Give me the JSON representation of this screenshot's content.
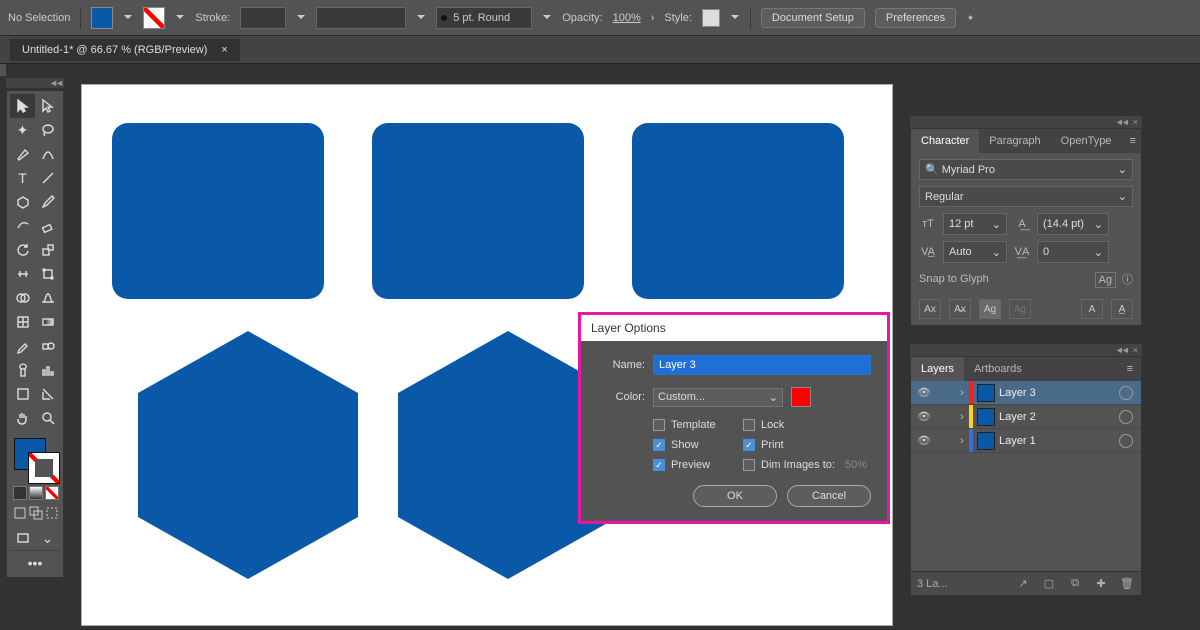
{
  "optbar": {
    "selection": "No Selection",
    "fill_color": "#0a58a8",
    "stroke_none": true,
    "stroke_label": "Stroke:",
    "brush_label": "5 pt. Round",
    "opacity_label": "Opacity:",
    "opacity_value": "100%",
    "style_label": "Style:",
    "doc_setup": "Document Setup",
    "prefs": "Preferences"
  },
  "tab": {
    "title": "Untitled-1* @ 66.67 % (RGB/Preview)",
    "close": "×"
  },
  "dialog": {
    "title": "Layer Options",
    "name_label": "Name:",
    "name_value": "Layer 3",
    "color_label": "Color:",
    "color_value": "Custom...",
    "color_swatch": "#ff0000",
    "template": "Template",
    "lock": "Lock",
    "show": "Show",
    "print": "Print",
    "preview": "Preview",
    "dim": "Dim Images to:",
    "dim_value": "50%",
    "ok": "OK",
    "cancel": "Cancel",
    "checks": {
      "template": false,
      "lock": false,
      "show": true,
      "print": true,
      "preview": true,
      "dim": false
    }
  },
  "char": {
    "tabs": [
      "Character",
      "Paragraph",
      "OpenType"
    ],
    "font": "Myriad Pro",
    "style": "Regular",
    "size": "12 pt",
    "leading": "(14.4 pt)",
    "kerning": "Auto",
    "tracking": "0",
    "snap_label": "Snap to Glyph"
  },
  "layers": {
    "tabs": [
      "Layers",
      "Artboards"
    ],
    "items": [
      {
        "name": "Layer 3",
        "color": "#ff1a1a",
        "selected": true
      },
      {
        "name": "Layer 2",
        "color": "#ffd11a",
        "selected": false
      },
      {
        "name": "Layer 1",
        "color": "#3a6fd8",
        "selected": false
      }
    ],
    "footer_count": "3 La..."
  }
}
